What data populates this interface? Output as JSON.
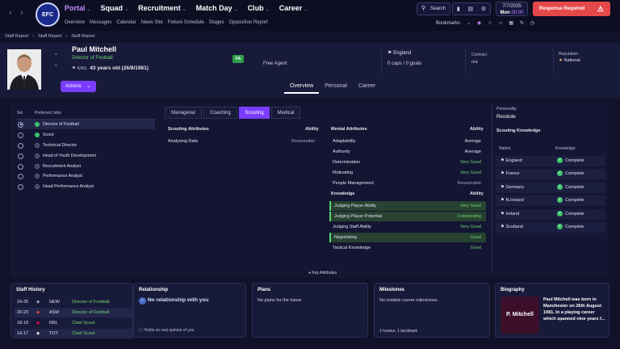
{
  "nav": {
    "menu": [
      {
        "label": "Portal",
        "active": true
      },
      {
        "label": "Squad"
      },
      {
        "label": "Recruitment"
      },
      {
        "label": "Match Day"
      },
      {
        "label": "Club"
      },
      {
        "label": "Career"
      }
    ],
    "submenu": [
      "Overview",
      "Messages",
      "Calendar",
      "News Site",
      "Fixture Schedule",
      "Stages",
      "Opposition Report"
    ],
    "search_label": "Search",
    "date_line1": "7/7/2025",
    "date_day": "Mon",
    "date_time": "00:00",
    "response_label": "Response Required",
    "bookmarks_label": "Bookmarks"
  },
  "breadcrumb": [
    "Staff Report",
    "Staff Report",
    "Staff Report"
  ],
  "profile": {
    "name": "Paul Mitchell",
    "role": "Director of Football",
    "nation_code": "ENG",
    "age_text": "43 years old (26/8/1981)",
    "badge": "FA",
    "contract_status": "Free Agent",
    "international_team": "England",
    "caps_goals": "0 caps / 0 goals",
    "contract_label": "Contract",
    "contract_value": "n/a",
    "reputation_label": "Reputation",
    "reputation_value": "National",
    "actions_label": "Actions"
  },
  "header_tabs": [
    {
      "label": "Overview",
      "active": true
    },
    {
      "label": "Personal"
    },
    {
      "label": "Career"
    }
  ],
  "jobs": {
    "col_sel": "Sel",
    "col_jobs": "Preferred Jobs",
    "items": [
      {
        "label": "Director of Football",
        "selected": true,
        "icon": "green"
      },
      {
        "label": "Scout",
        "selected": false,
        "icon": "green"
      },
      {
        "label": "Technical Director",
        "selected": false,
        "icon": "dim"
      },
      {
        "label": "Head of Youth Development",
        "selected": false,
        "icon": "dim"
      },
      {
        "label": "Recruitment Analyst",
        "selected": false,
        "icon": "dim"
      },
      {
        "label": "Performance Analyst",
        "selected": false,
        "icon": "dim"
      },
      {
        "label": "Head Performance Analyst",
        "selected": false,
        "icon": "dim"
      }
    ]
  },
  "attr_tabs": [
    {
      "label": "Managerial"
    },
    {
      "label": "Coaching"
    },
    {
      "label": "Scouting",
      "active": true
    },
    {
      "label": "Medical"
    }
  ],
  "scouting": {
    "header": "Scouting Attributes",
    "ability_header": "Ability",
    "rows": [
      {
        "label": "Analysing Data",
        "value": "Reasonable"
      }
    ]
  },
  "mental": {
    "header": "Mental Attributes",
    "ability_header": "Ability",
    "rows": [
      {
        "label": "Adaptability",
        "value": "Average"
      },
      {
        "label": "Authority",
        "value": "Average"
      },
      {
        "label": "Determination",
        "value": "Very Good"
      },
      {
        "label": "Motivating",
        "value": "Very Good"
      },
      {
        "label": "People Management",
        "value": "Reasonable"
      }
    ]
  },
  "knowledge": {
    "header": "Knowledge",
    "ability_header": "Ability",
    "rows": [
      {
        "label": "Judging Player Ability",
        "value": "Very Good"
      },
      {
        "label": "Judging Player Potential",
        "value": "Outstanding"
      },
      {
        "label": "Judging Staff Ability",
        "value": "Very Good"
      },
      {
        "label": "Negotiating",
        "value": "Good"
      },
      {
        "label": "Tactical Knowledge",
        "value": "Good"
      }
    ]
  },
  "key_attributes_label": "Key Attributes",
  "personality": {
    "label": "Personality",
    "value": "Resolute"
  },
  "scouting_knowledge": {
    "title": "Scouting Knowledge",
    "col_nation": "Nation",
    "col_knowledge": "Knowledge",
    "rows": [
      {
        "nation": "England",
        "status": "Complete"
      },
      {
        "nation": "France",
        "status": "Complete"
      },
      {
        "nation": "Germany",
        "status": "Complete"
      },
      {
        "nation": "N.Ireland",
        "status": "Complete"
      },
      {
        "nation": "Ireland",
        "status": "Complete"
      },
      {
        "nation": "Scotland",
        "status": "Complete"
      }
    ]
  },
  "staff_history": {
    "title": "Staff History",
    "rows": [
      {
        "years": "24-25",
        "club": "NEW",
        "role": "Director of Football"
      },
      {
        "years": "20-23",
        "club": "ASM",
        "role": "Director of Football"
      },
      {
        "years": "18-19",
        "club": "RBL",
        "role": "Chief Scout"
      },
      {
        "years": "14-17",
        "club": "TOT",
        "role": "Chief Scout"
      }
    ]
  },
  "relationship": {
    "title": "Relationship",
    "text": "No relationship with you",
    "footnote": "Holds no real opinion of you"
  },
  "plans": {
    "title": "Plans",
    "text": "No plans for the future"
  },
  "milestones": {
    "title": "Milestones",
    "text": "No notable career milestones.",
    "footnote": "1 honour, 1 landmark"
  },
  "biography": {
    "title": "Biography",
    "card": "P. Mitchell",
    "text": "Paul Mitchell was born in Manchester on 26th August 1981. In a playing career which spanned nine years f..."
  },
  "colors": {
    "accent": "#7a3cff",
    "good": "#6fd76f",
    "alert": "#e54848"
  }
}
